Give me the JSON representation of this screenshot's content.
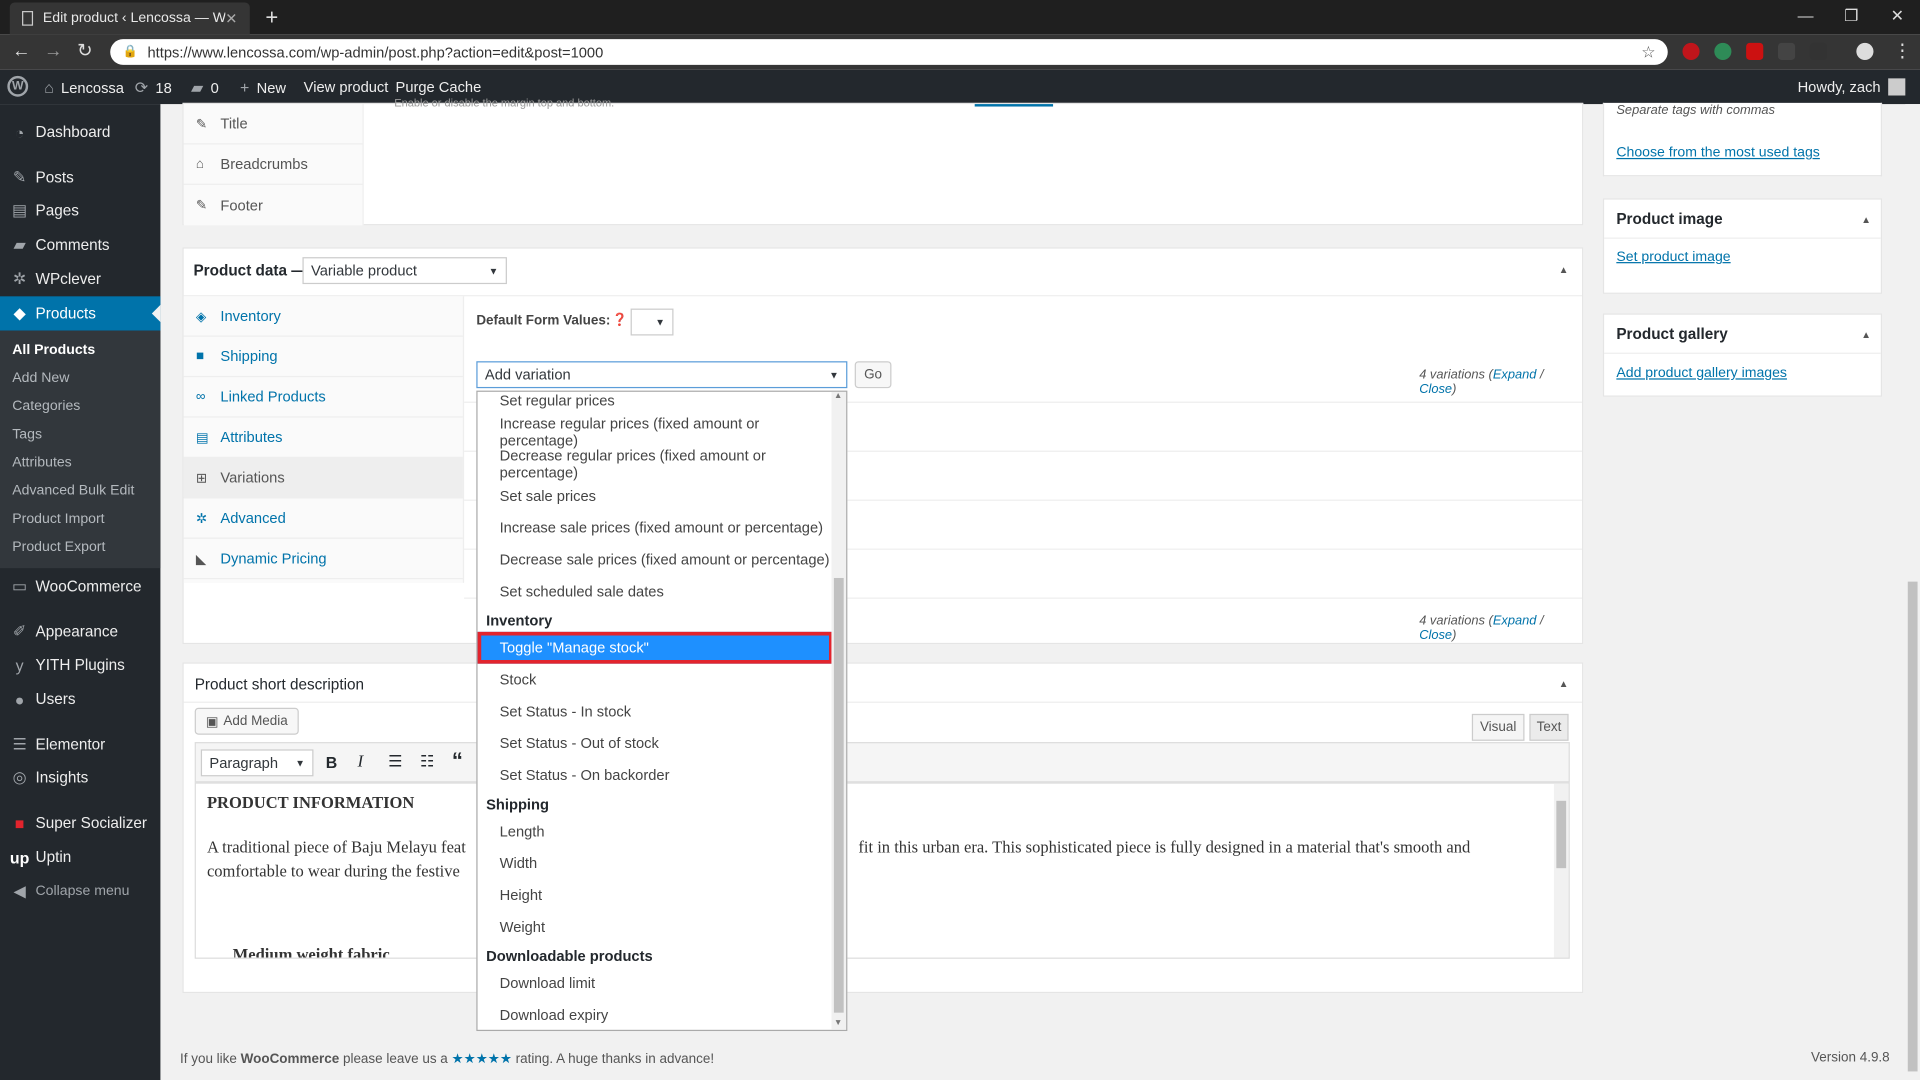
{
  "browser": {
    "tab_title": "Edit product ‹ Lencossa — Word",
    "url": "https://www.lencossa.com/wp-admin/post.php?action=edit&post=1000"
  },
  "adminbar": {
    "site": "Lencossa",
    "updates": "18",
    "comments": "0",
    "new": "New",
    "view": "View product",
    "purge": "Purge Cache",
    "howdy": "Howdy, zach"
  },
  "sidebar": {
    "items": [
      {
        "label": "Dashboard",
        "icon": "dashboard-icon"
      },
      {
        "label": "Posts",
        "icon": "pin-icon"
      },
      {
        "label": "Pages",
        "icon": "pages-icon"
      },
      {
        "label": "Comments",
        "icon": "comment-icon"
      },
      {
        "label": "WPclever",
        "icon": "gear-icon"
      },
      {
        "label": "Products",
        "icon": "box-icon"
      },
      {
        "label": "WooCommerce",
        "icon": "woo-icon"
      },
      {
        "label": "Appearance",
        "icon": "brush-icon"
      },
      {
        "label": "YITH Plugins",
        "icon": "yith-icon"
      },
      {
        "label": "Users",
        "icon": "user-icon"
      },
      {
        "label": "Elementor",
        "icon": "elementor-icon"
      },
      {
        "label": "Insights",
        "icon": "chart-icon"
      },
      {
        "label": "Super Socializer",
        "icon": "social-icon"
      },
      {
        "label": "Uptin",
        "icon": "up-icon"
      },
      {
        "label": "Collapse menu",
        "icon": "collapse-icon"
      }
    ],
    "sub": [
      "All Products",
      "Add New",
      "Categories",
      "Tags",
      "Attributes",
      "Advanced Bulk Edit",
      "Product Import",
      "Product Export"
    ]
  },
  "topbox": {
    "tabs": [
      "Title",
      "Breadcrumbs",
      "Footer"
    ],
    "note": "Enable or disable the margin top and bottom."
  },
  "product_data": {
    "label": "Product data —",
    "type": "Variable product",
    "tabs": [
      "Inventory",
      "Shipping",
      "Linked Products",
      "Attributes",
      "Variations",
      "Advanced",
      "Dynamic Pricing"
    ],
    "default_form": "Default Form Values:",
    "bulk_select": "Add variation",
    "go": "Go",
    "variations_count": "4 variations",
    "expand": "Expand",
    "close": "Close"
  },
  "dropdown": {
    "top": [
      "Set regular prices",
      "Increase regular prices (fixed amount or percentage)",
      "Decrease regular prices (fixed amount or percentage)",
      "Set sale prices",
      "Increase sale prices (fixed amount or percentage)",
      "Decrease sale prices (fixed amount or percentage)",
      "Set scheduled sale dates"
    ],
    "inventory_label": "Inventory",
    "inventory": [
      "Toggle \"Manage stock\"",
      "Stock",
      "Set Status - In stock",
      "Set Status - Out of stock",
      "Set Status - On backorder"
    ],
    "shipping_label": "Shipping",
    "shipping": [
      "Length",
      "Width",
      "Height",
      "Weight"
    ],
    "downloads_label": "Downloadable products",
    "downloads": [
      "Download limit",
      "Download expiry"
    ]
  },
  "short_desc": {
    "title": "Product short description",
    "add_media": "Add Media",
    "visual": "Visual",
    "text": "Text",
    "format": "Paragraph",
    "heading": "PRODUCT INFORMATION",
    "para1a": "A traditional piece of Baju Melayu feat",
    "para1b": "fit in this urban era. This sophisticated piece is fully designed in a material that's smooth and",
    "para2": "comfortable to wear during the festive",
    "bullet": "Medium weight fabric"
  },
  "right": {
    "tags_hint": "Separate tags with commas",
    "tags_link": "Choose from the most used tags",
    "image_title": "Product image",
    "image_link": "Set product image",
    "gallery_title": "Product gallery",
    "gallery_link": "Add product gallery images"
  },
  "footer": {
    "pre": "If you like",
    "brand": "WooCommerce",
    "mid": "please leave us a",
    "stars": "★★★★★",
    "post": "rating. A huge thanks in advance!",
    "version": "Version 4.9.8"
  }
}
